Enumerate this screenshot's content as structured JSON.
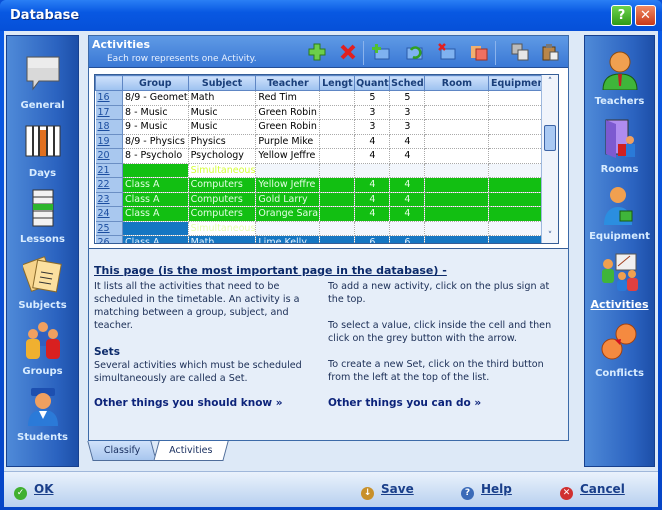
{
  "window": {
    "title": "Database",
    "help_glyph": "?",
    "close_glyph": "✕"
  },
  "left_nav": [
    {
      "label": "General",
      "icon": "speech-bubble-icon"
    },
    {
      "label": "Days",
      "icon": "days-columns-icon"
    },
    {
      "label": "Lessons",
      "icon": "lessons-stack-icon"
    },
    {
      "label": "Subjects",
      "icon": "notes-icon"
    },
    {
      "label": "Groups",
      "icon": "group-people-icon"
    },
    {
      "label": "Students",
      "icon": "student-icon"
    }
  ],
  "right_nav": [
    {
      "label": "Teachers",
      "icon": "teacher-icon"
    },
    {
      "label": "Rooms",
      "icon": "room-door-icon"
    },
    {
      "label": "Equipment",
      "icon": "equipment-icon"
    },
    {
      "label": "Activities",
      "icon": "activities-icon",
      "active": true
    },
    {
      "label": "Conflicts",
      "icon": "conflicts-icon"
    }
  ],
  "panel": {
    "title": "Activities",
    "subtitle": "Each row represents one Activity.",
    "toolbar": [
      "add-icon",
      "delete-icon",
      "new-set-icon",
      "refresh-set-icon",
      "remove-set-icon",
      "folder-icon",
      "copy-icon",
      "paste-icon"
    ]
  },
  "grid": {
    "columns": [
      "",
      "Group",
      "Subject",
      "Teacher",
      "Lengt",
      "Quant",
      "Sched",
      "Room",
      "Equipment"
    ],
    "rows": [
      {
        "n": "16",
        "group": "8/9 - Geomet",
        "subject": "Math",
        "teacher": "Red Tim",
        "length": "",
        "quant": "5",
        "sched": "5",
        "room": "",
        "equipment": "",
        "style": ""
      },
      {
        "n": "17",
        "group": "8 - Music",
        "subject": "Music",
        "teacher": "Green Robin",
        "length": "",
        "quant": "3",
        "sched": "3",
        "room": "",
        "equipment": "",
        "style": ""
      },
      {
        "n": "18",
        "group": "9 - Music",
        "subject": "Music",
        "teacher": "Green Robin",
        "length": "",
        "quant": "3",
        "sched": "3",
        "room": "",
        "equipment": "",
        "style": ""
      },
      {
        "n": "19",
        "group": "8/9 - Physics",
        "subject": "Physics",
        "teacher": "Purple Mike",
        "length": "",
        "quant": "4",
        "sched": "4",
        "room": "",
        "equipment": "",
        "style": ""
      },
      {
        "n": "20",
        "group": "8 - Psycholo",
        "subject": "Psychology",
        "teacher": "Yellow Jeffre",
        "length": "",
        "quant": "4",
        "sched": "4",
        "room": "",
        "equipment": "",
        "style": ""
      },
      {
        "n": "21",
        "group": "",
        "subject": "Simultaneous",
        "teacher": "",
        "length": "",
        "quant": "",
        "sched": "",
        "room": "",
        "equipment": "",
        "style": "gs"
      },
      {
        "n": "22",
        "group": "Class A",
        "subject": "Computers",
        "teacher": "Yellow Jeffre",
        "length": "",
        "quant": "4",
        "sched": "4",
        "room": "",
        "equipment": "",
        "style": "g"
      },
      {
        "n": "23",
        "group": "Class A",
        "subject": "Computers",
        "teacher": "Gold Larry",
        "length": "",
        "quant": "4",
        "sched": "4",
        "room": "",
        "equipment": "",
        "style": "g"
      },
      {
        "n": "24",
        "group": "Class A",
        "subject": "Computers",
        "teacher": "Orange Sara",
        "length": "",
        "quant": "4",
        "sched": "4",
        "room": "",
        "equipment": "",
        "style": "g"
      },
      {
        "n": "25",
        "group": "",
        "subject": "Simultaneous",
        "teacher": "",
        "length": "",
        "quant": "",
        "sched": "",
        "room": "",
        "equipment": "",
        "style": "bs"
      },
      {
        "n": "26",
        "group": "Class A",
        "subject": "Math",
        "teacher": "Lime Kelly",
        "length": "",
        "quant": "6",
        "sched": "6",
        "room": "",
        "equipment": "",
        "style": "b"
      }
    ],
    "scroll_up": "˄",
    "scroll_down": "˅"
  },
  "info": {
    "title": "This page (is the most important page in the database) -",
    "left_para": "It lists all the activities that need to be scheduled in the timetable. An activity is a matching between a group, subject, and teacher.",
    "sets_heading": "Sets",
    "sets_para": "Several activities which must be scheduled simultaneously are called a Set.",
    "left_link": "Other things you should know »",
    "right_para1": "To add a new activity, click on the plus sign at the top.",
    "right_para2": "To select a value, click inside the cell and then click on the grey button with the arrow.",
    "right_para3": "To create a new Set, click on the third button from the left at the top of the list.",
    "right_link": "Other things you can do »"
  },
  "tabs": [
    {
      "label": "Classify"
    },
    {
      "label": "Activities",
      "active": true
    }
  ],
  "footer": {
    "ok": "OK",
    "save": "Save",
    "help": "Help",
    "cancel": "Cancel"
  },
  "colors": {
    "set_green": "#12bf12",
    "set_blue": "#1576c2",
    "accent": "#0858e2"
  }
}
